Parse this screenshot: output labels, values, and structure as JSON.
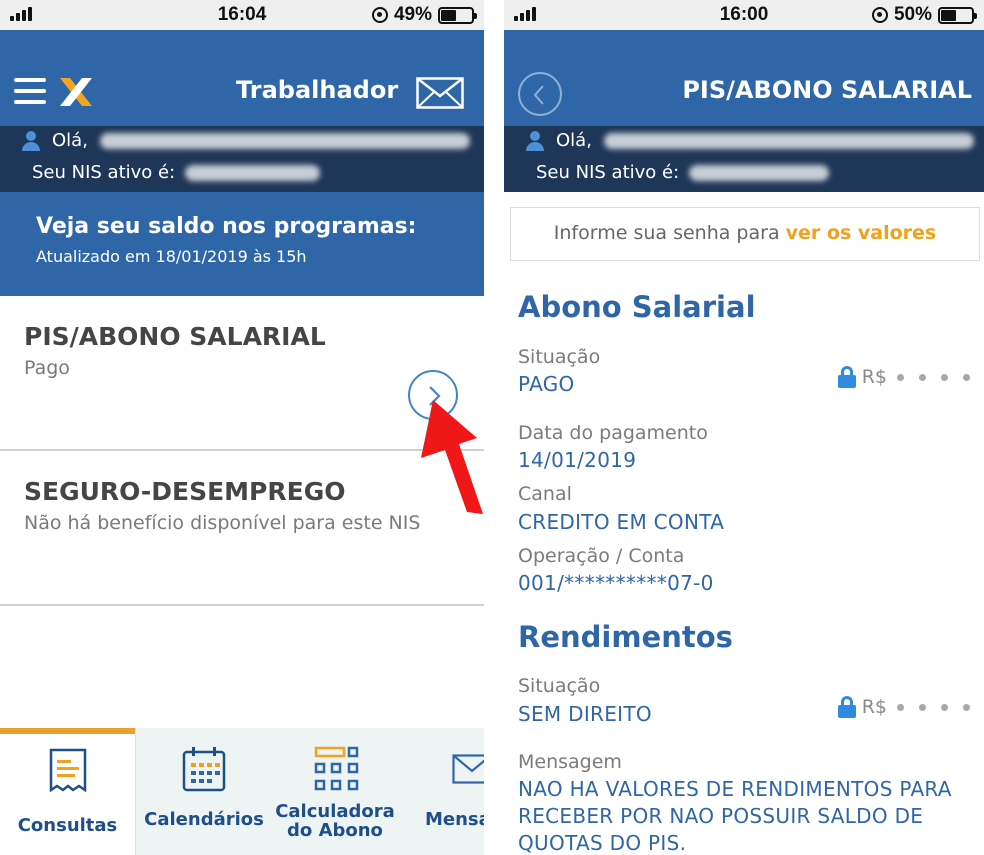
{
  "left": {
    "status": {
      "time": "16:04",
      "battery": "49%",
      "battery_level": 0.49
    },
    "header": {
      "title": "Trabalhador"
    },
    "user": {
      "greeting": "Olá,",
      "nis_label": "Seu NIS ativo é:"
    },
    "saldo": {
      "title": "Veja seu saldo nos programas:",
      "updated": "Atualizado em 18/01/2019 às 15h"
    },
    "programs": [
      {
        "title": "PIS/ABONO SALARIAL",
        "status": "Pago"
      },
      {
        "title": "SEGURO-DESEMPREGO",
        "status": "Não há benefício disponível para este NIS"
      }
    ],
    "tabs": [
      {
        "label": "Consultas"
      },
      {
        "label": "Calendários"
      },
      {
        "label": "Calculadora do Abono"
      },
      {
        "label": "Mensa"
      }
    ]
  },
  "right": {
    "status": {
      "time": "16:00",
      "battery": "50%",
      "battery_level": 0.5
    },
    "header": {
      "title": "PIS/ABONO SALARIAL"
    },
    "user": {
      "greeting": "Olá,",
      "nis_label": "Seu NIS ativo é:"
    },
    "senha": {
      "prefix": "Informe sua senha para",
      "link": "ver os valores"
    },
    "abono": {
      "title": "Abono Salarial",
      "situacao_label": "Situação",
      "situacao": "PAGO",
      "currency": "R$",
      "data_label": "Data do pagamento",
      "data": "14/01/2019",
      "canal_label": "Canal",
      "canal": "CREDITO EM CONTA",
      "operacao_label": "Operação / Conta",
      "operacao": "001/**********07-0"
    },
    "rendimentos": {
      "title": "Rendimentos",
      "situacao_label": "Situação",
      "situacao": "SEM DIREITO",
      "currency": "R$",
      "mensagem_label": "Mensagem",
      "mensagem": "NAO HA VALORES DE RENDIMENTOS PARA RECEBER POR NAO POSSUIR SALDO DE QUOTAS DO PIS."
    }
  }
}
